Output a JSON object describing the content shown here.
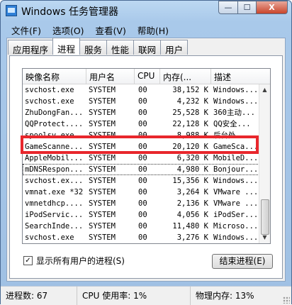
{
  "window": {
    "title": "Windows 任务管理器",
    "buttons": {
      "min": "—",
      "max": "☐",
      "close": "X"
    }
  },
  "menu": [
    "文件(F)",
    "选项(O)",
    "查看(V)",
    "帮助(H)"
  ],
  "tabs": [
    "应用程序",
    "进程",
    "服务",
    "性能",
    "联网",
    "用户"
  ],
  "active_tab": "进程",
  "columns": [
    "映像名称",
    "用户名",
    "CPU",
    "内存(...",
    "描述"
  ],
  "rows": [
    {
      "name": "svchost.exe",
      "user": "SYSTEM",
      "cpu": "00",
      "mem": "38,152 K",
      "desc": "Windows..."
    },
    {
      "name": "svchost.exe",
      "user": "SYSTEM",
      "cpu": "00",
      "mem": "4,232 K",
      "desc": "Windows..."
    },
    {
      "name": "ZhuDongFan...",
      "user": "SYSTEM",
      "cpu": "00",
      "mem": "25,528 K",
      "desc": "360主动..."
    },
    {
      "name": "QQProtect....",
      "user": "SYSTEM",
      "cpu": "00",
      "mem": "22,128 K",
      "desc": "QQ安全..."
    },
    {
      "name": "spoolsv.exe",
      "user": "SYSTEM",
      "cpu": "00",
      "mem": "8,988 K",
      "desc": "后台处..."
    },
    {
      "name": "GameScanne...",
      "user": "SYSTEM",
      "cpu": "00",
      "mem": "20,120 K",
      "desc": "GameSca..."
    },
    {
      "name": "AppleMobil...",
      "user": "SYSTEM",
      "cpu": "00",
      "mem": "6,320 K",
      "desc": "MobileD..."
    },
    {
      "name": "mDNSRespon...",
      "user": "SYSTEM",
      "cpu": "00",
      "mem": "4,980 K",
      "desc": "Bonjour..."
    },
    {
      "name": "svchost.ex...",
      "user": "SYSTEM",
      "cpu": "00",
      "mem": "15,356 K",
      "desc": "Windows..."
    },
    {
      "name": "vmnat.exe *32",
      "user": "SYSTEM",
      "cpu": "00",
      "mem": "3,264 K",
      "desc": "VMware ..."
    },
    {
      "name": "vmnetdhcp....",
      "user": "SYSTEM",
      "cpu": "00",
      "mem": "2,136 K",
      "desc": "VMware ..."
    },
    {
      "name": "iPodServic...",
      "user": "SYSTEM",
      "cpu": "00",
      "mem": "4,056 K",
      "desc": "iPodSer..."
    },
    {
      "name": "SearchInde...",
      "user": "SYSTEM",
      "cpu": "00",
      "mem": "11,480 K",
      "desc": "Microso..."
    },
    {
      "name": "svchost.exe",
      "user": "SYSTEM",
      "cpu": "00",
      "mem": "3,276 K",
      "desc": "Windows..."
    },
    {
      "name": "vmware-aut...",
      "user": "SYSTEM",
      "cpu": "00",
      "mem": "4,660 K",
      "desc": "VMware ..."
    }
  ],
  "show_all_users": {
    "label": "显示所有用户的进程(S)",
    "checked": "✓"
  },
  "end_process_label": "结束进程(E)",
  "status": {
    "processes": "进程数: 67",
    "cpu": "CPU 使用率: 1%",
    "memory": "物理内存: 13%"
  },
  "highlight_color": "#e8262c"
}
